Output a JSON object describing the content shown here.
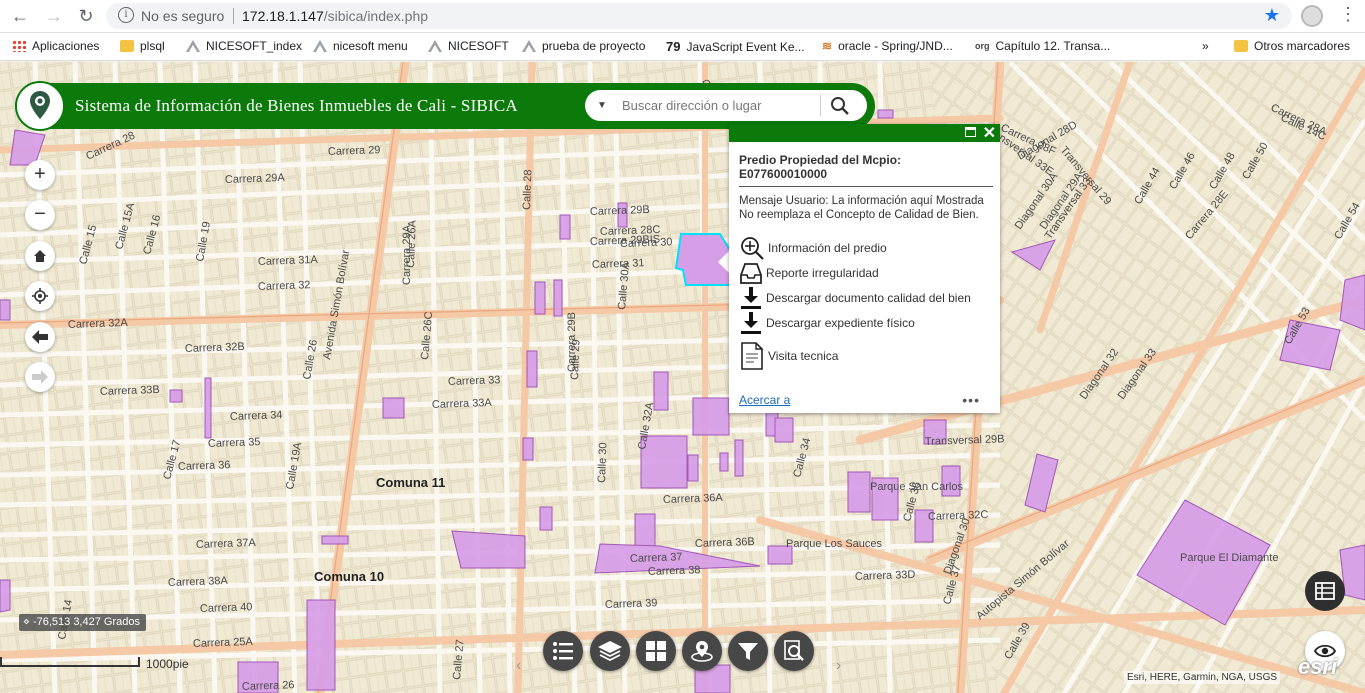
{
  "browser": {
    "security_label": "No es seguro",
    "url_host": "172.18.1.147",
    "url_path": "/sibica/index.php",
    "bookmarks": [
      {
        "label": "Aplicaciones",
        "icon": "apps-grid-icon"
      },
      {
        "label": "plsql",
        "icon": "folder-icon"
      },
      {
        "label": "NICESOFT_index",
        "icon": "page-icon"
      },
      {
        "label": "nicesoft menu",
        "icon": "page-icon"
      },
      {
        "label": "NICESOFT",
        "icon": "page-icon"
      },
      {
        "label": "prueba de proyecto",
        "icon": "page-icon"
      },
      {
        "label": "JavaScript Event Ke...",
        "icon": "badge-79-icon",
        "badge": "79"
      },
      {
        "label": "oracle - Spring/JND...",
        "icon": "stackoverflow-icon"
      },
      {
        "label": "Capítulo 12. Transa...",
        "icon": "org-icon",
        "badge": "org"
      }
    ],
    "overflow_label": "»",
    "other_bookmarks": "Otros marcadores"
  },
  "app": {
    "title": "Sistema de Información de Bienes Inmuebles de Cali - SIBICA",
    "search_placeholder": "Buscar dirección o lugar",
    "brand_color": "#0b7a0b"
  },
  "popup": {
    "title_line1": "Predio Propiedad del Mcpio:",
    "title_line2": "E077600010000",
    "message": "Mensaje Usuario: La información aquí Mostrada No reemplaza el Concepto de Calidad de Bien.",
    "items": [
      {
        "label": "Información del predio",
        "icon": "zoom-in-icon"
      },
      {
        "label": "Reporte irregularidad",
        "icon": "inbox-icon"
      },
      {
        "label": "Descargar documento calidad del bien",
        "icon": "download-icon"
      },
      {
        "label": "Descargar expediente físico",
        "icon": "download-icon"
      },
      {
        "label": "Visita tecnica",
        "icon": "document-icon"
      }
    ],
    "zoom_link": "Acercar a",
    "more": "•••"
  },
  "map": {
    "coordinates": "-76,513 3,427 Grados",
    "scale": "1000pie",
    "attribution": "Esri, HERE, Garmin, NGA, USGS",
    "esri_logo": "esri",
    "parcel_color": "#d79ee8",
    "comunas": [
      "Comuna 11",
      "Comuna 10"
    ],
    "parks": [
      "Parque Los Sauces",
      "Parque El Diamante",
      "Parque San Carlos"
    ],
    "streets": [
      "Carrera 29",
      "Carrera 29A",
      "Carrera 29B",
      "Carrera 30",
      "Carrera 31",
      "Carrera 31A",
      "Carrera 32",
      "Carrera 32A",
      "Carrera 32B",
      "Carrera 33",
      "Carrera 33A",
      "Carrera 33B",
      "Carrera 34",
      "Carrera 35",
      "Carrera 36",
      "Carrera 36A",
      "Carrera 36B",
      "Carrera 37",
      "Carrera 37A",
      "Carrera 38",
      "Carrera 38A",
      "Carrera 39",
      "Carrera 40",
      "Carrera 25A",
      "Carrera 26",
      "Carrera 28",
      "Carrera 29A",
      "Carrera 29B",
      "Carrera 29BIS",
      "Carrera 28D",
      "Carrera 28C",
      "Carrera 28F",
      "Carrera 28A",
      "Carrera 28E",
      "Calle 14C",
      "Calle 15",
      "Calle 15A",
      "Calle 16",
      "Calle 17",
      "Calle 19",
      "Calle 19A",
      "Calle 26",
      "Calle 26A",
      "Calle 26C",
      "Calle 27",
      "Calle 28",
      "Calle 29",
      "Calle 30",
      "Calle 30A",
      "Calle 32A",
      "Calle 33",
      "Calle 34",
      "Calle 36",
      "Calle 37",
      "Calle 39",
      "Calle 44",
      "Calle 46",
      "Calle 48",
      "Calle 50",
      "Calle 53",
      "Calle 54",
      "Calle 14",
      "Avenida Simón Bolívar",
      "Autopista Simón Bolívar",
      "Diagonal 29A",
      "Diagonal 30",
      "Diagonal 30A",
      "Diagonal 32",
      "Diagonal 33",
      "Diagonal 28D",
      "Transversal 29",
      "Transversal 33",
      "Transversal 33E",
      "Transversal 29B",
      "Carrera 32C",
      "Carrera 33D",
      "Carrera 33B"
    ]
  },
  "toolbar": {
    "buttons": [
      "list-icon",
      "layers-icon",
      "basemap-grid-icon",
      "location-icon",
      "filter-icon",
      "search-doc-icon"
    ],
    "prev": "‹",
    "next": "›"
  }
}
